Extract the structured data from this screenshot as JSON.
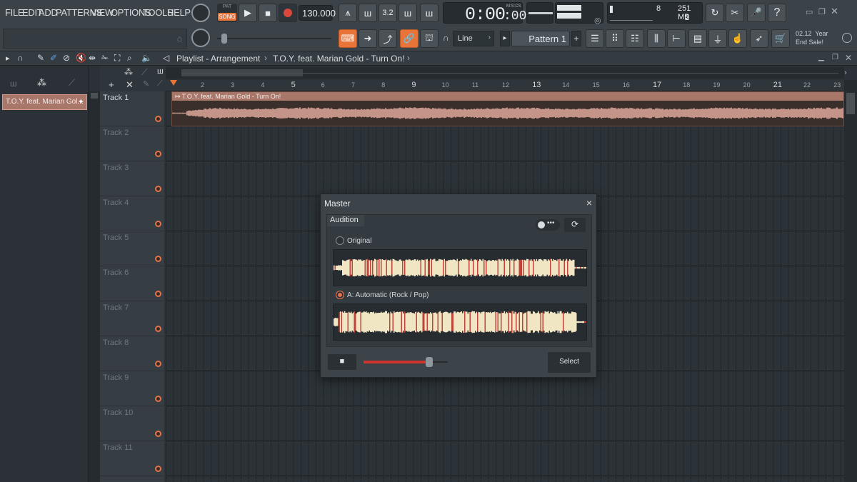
{
  "menu": [
    "FILE",
    "EDIT",
    "ADD",
    "PATTERNS",
    "VIEW",
    "OPTIONS",
    "TOOLS",
    "HELP"
  ],
  "transport": {
    "pat_label": "PAT",
    "song_label": "SONG",
    "tempo": "130.000",
    "time": "0:00",
    "time_sub": ":00",
    "time_format": "M:S:CS"
  },
  "monitor": {
    "cpu_count": "8",
    "memory": "251 MB",
    "poly": "2"
  },
  "promo": {
    "line1": "02.12  Year",
    "line2": "End Sale!"
  },
  "snap": {
    "label": "Line"
  },
  "pattern": {
    "label": "Pattern 1"
  },
  "playlist": {
    "breadcrumb": "Playlist - Arrangement",
    "sep": "›",
    "song": "T.O.Y. feat. Marian Gold - Turn On!",
    "picker_item": "T.O.Y. feat. Marian Gol..."
  },
  "ruler_ticks": [
    "2",
    "3",
    "4",
    "5",
    "6",
    "7",
    "8",
    "9",
    "10",
    "11",
    "12",
    "13",
    "14",
    "15",
    "16",
    "17",
    "18",
    "19",
    "20",
    "21",
    "22",
    "23"
  ],
  "tracks": [
    "Track 1",
    "Track 2",
    "Track 3",
    "Track 4",
    "Track 5",
    "Track 6",
    "Track 7",
    "Track 8",
    "Track 9",
    "Track 10",
    "Track 11"
  ],
  "clip": {
    "title": "T.O.Y. feat. Marian Gold - Turn On!"
  },
  "master_dialog": {
    "title": "Master",
    "close": "×",
    "tab": "Audition",
    "option_original": "Original",
    "option_auto": "A: Automatic (Rock / Pop)",
    "select_button": "Select",
    "volume_fraction": 0.78
  },
  "colors": {
    "accent": "#e9743a",
    "clip": "#c49488",
    "wave_light": "#f1e6c4",
    "wave_red": "#c0433a"
  }
}
